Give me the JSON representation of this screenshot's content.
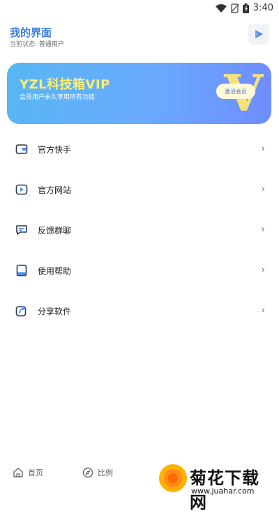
{
  "status_bar": {
    "time": "3:40"
  },
  "header": {
    "title": "我的界面",
    "status_label": "当前状态:",
    "status_value": "普通用户"
  },
  "vip_card": {
    "title": "YZL科技箱VIP",
    "description": "会员用户永久享用所有功能",
    "badge_letter": "V",
    "activate_label": "激活会员"
  },
  "menu": {
    "items": [
      {
        "label": "官方快手",
        "icon": "wallet-icon"
      },
      {
        "label": "官方网站",
        "icon": "video-play-icon"
      },
      {
        "label": "反馈群聊",
        "icon": "chat-icon"
      },
      {
        "label": "使用帮助",
        "icon": "book-icon"
      },
      {
        "label": "分享软件",
        "icon": "share-icon"
      }
    ],
    "chevron": "›"
  },
  "bottom_nav": {
    "home_label": "首页",
    "ratio_label": "比例"
  },
  "watermark": {
    "name": "菊花下载网",
    "url": "www.juahar.com"
  },
  "colors": {
    "accent": "#3b7de0",
    "vip_yellow": "#fff06a"
  }
}
